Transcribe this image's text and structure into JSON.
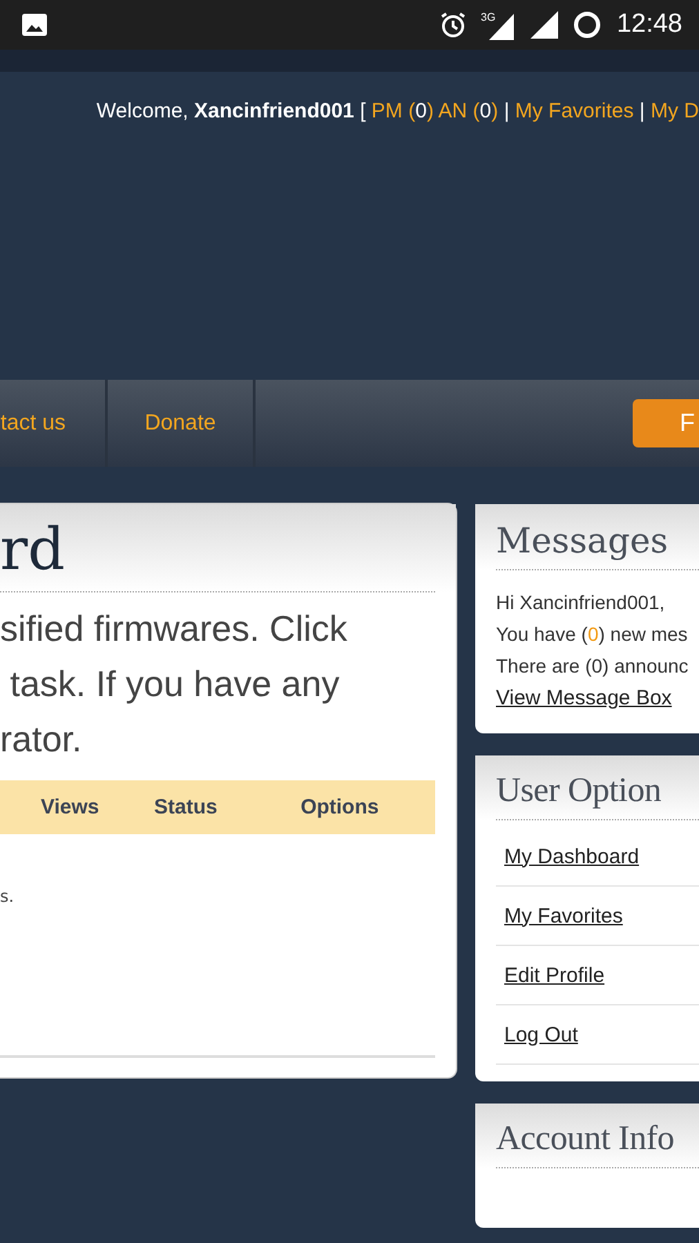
{
  "status_bar": {
    "time": "12:48",
    "network": "3G"
  },
  "header": {
    "segments": [
      {
        "kind": "text",
        "text": "Welcome,"
      },
      {
        "kind": "bold",
        "text": "Xancinfriend001"
      },
      {
        "kind": "text",
        "text": "["
      },
      {
        "kind": "link",
        "label": "PM",
        "open": "(",
        "count": "0",
        "close": ")"
      },
      {
        "kind": "link",
        "label": "AN",
        "open": "(",
        "count": "0",
        "close": ")"
      },
      {
        "kind": "text",
        "text": "|"
      },
      {
        "kind": "link",
        "label": "My Favorites"
      },
      {
        "kind": "text",
        "text": "|"
      },
      {
        "kind": "link",
        "label": "My D"
      }
    ]
  },
  "nav": {
    "items": [
      "tact us",
      "Donate"
    ],
    "button": "F"
  },
  "main_card": {
    "title": "rd",
    "intro_lines": [
      "sified firmwares. Click",
      " task. If you have any",
      "rator."
    ],
    "table": {
      "columns": [
        "Views",
        "Status",
        "Options"
      ]
    },
    "empty_text": "s."
  },
  "messages": {
    "title": "Messages",
    "greeting": "Hi Xancinfriend001,",
    "new_prefix": "You have (",
    "new_count": "0",
    "new_suffix": ") new mes",
    "announcements": "There are (0) announc",
    "link": "View Message Box"
  },
  "user_options": {
    "title": "User Option",
    "items": [
      "My Dashboard",
      "My Favorites",
      "Edit Profile",
      "Log Out"
    ]
  },
  "account_info": {
    "title": "Account Info"
  }
}
